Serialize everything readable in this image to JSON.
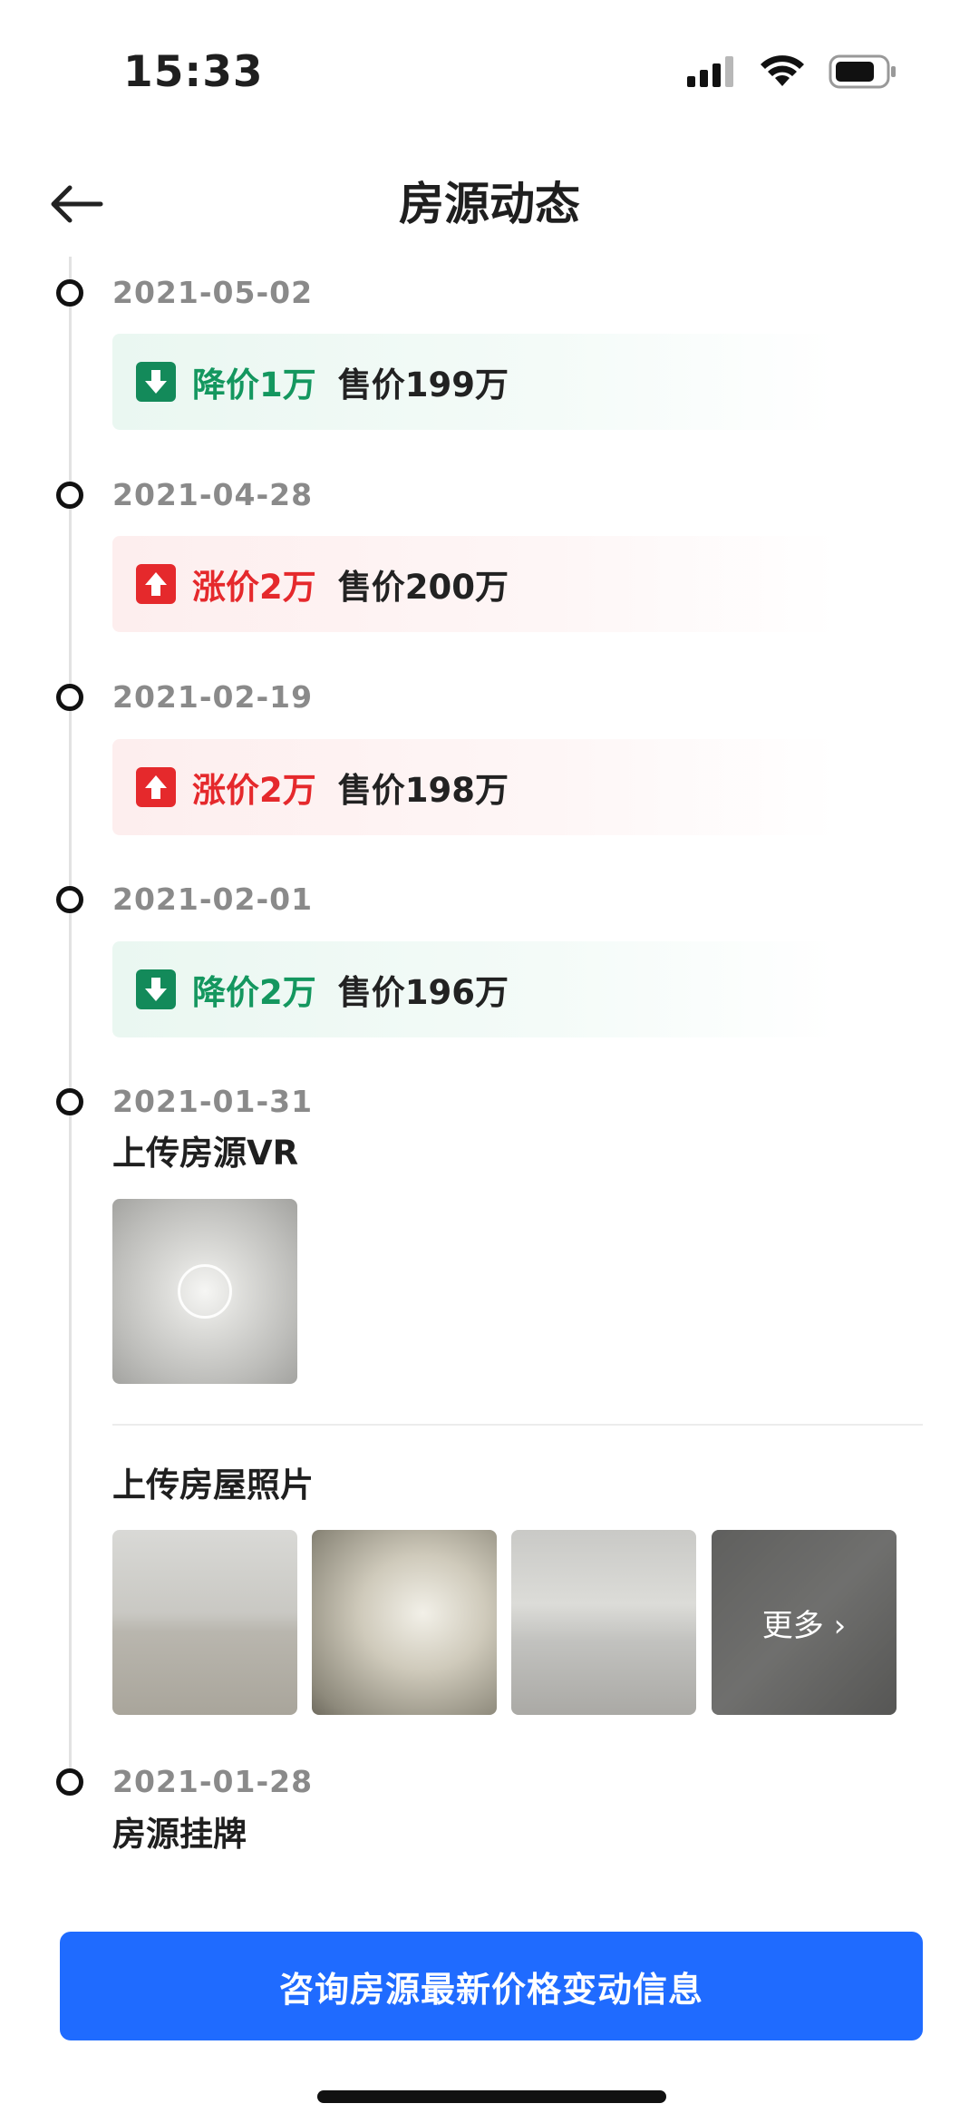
{
  "status_bar": {
    "time": "15:33"
  },
  "header": {
    "title": "房源动态"
  },
  "timeline": {
    "price_events": [
      {
        "date": "2021-05-02",
        "change": "降价1万",
        "price": "售价199万",
        "direction": "down"
      },
      {
        "date": "2021-04-28",
        "change": "涨价2万",
        "price": "售价200万",
        "direction": "up"
      },
      {
        "date": "2021-02-19",
        "change": "涨价2万",
        "price": "售价198万",
        "direction": "up"
      },
      {
        "date": "2021-02-01",
        "change": "降价2万",
        "price": "售价196万",
        "direction": "down"
      }
    ],
    "vr_event": {
      "date": "2021-01-31",
      "title": "上传房源VR"
    },
    "photo_event": {
      "title": "上传房屋照片",
      "more_label": "更多 ›"
    },
    "listing_event": {
      "date": "2021-01-28",
      "title": "房源挂牌"
    }
  },
  "cta": {
    "label": "咨询房源最新价格变动信息"
  },
  "colors": {
    "down": "#14975f",
    "up": "#e5292c",
    "cta": "#1f6bff"
  }
}
